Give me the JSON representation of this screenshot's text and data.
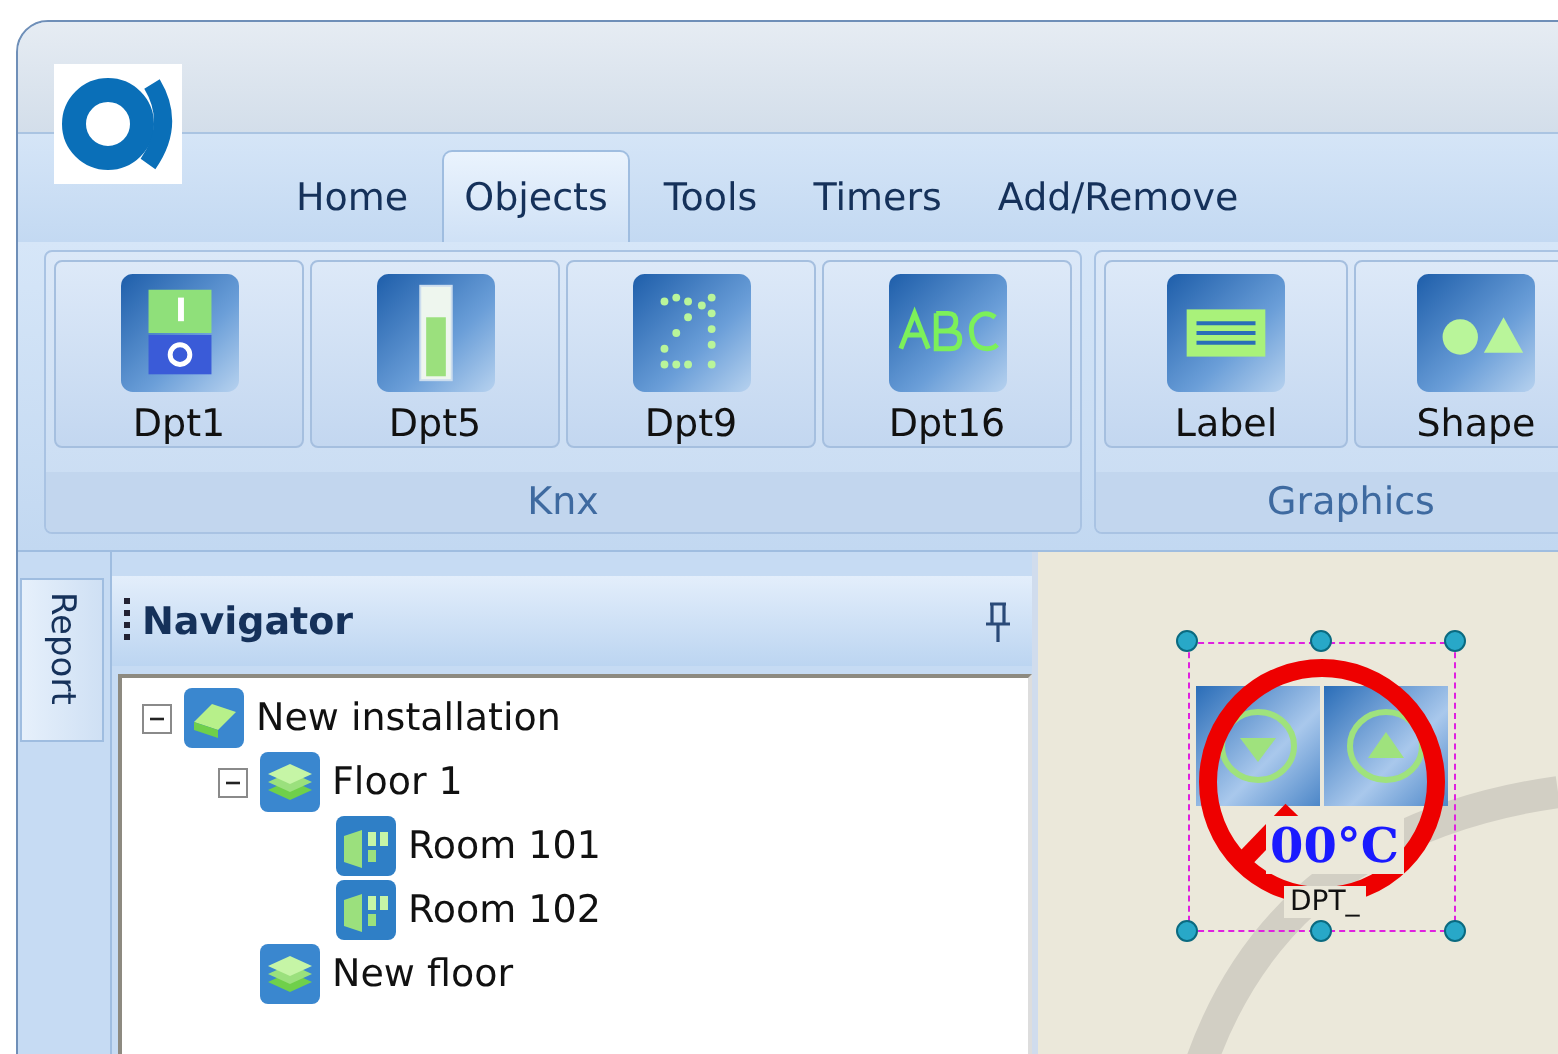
{
  "ribbon": {
    "tabs": [
      {
        "label": "Home",
        "selected": false
      },
      {
        "label": "Objects",
        "selected": true
      },
      {
        "label": "Tools",
        "selected": false
      },
      {
        "label": "Timers",
        "selected": false
      },
      {
        "label": "Add/Remove",
        "selected": false
      }
    ],
    "groups": [
      {
        "label": "Knx",
        "buttons": [
          {
            "label": "Dpt1",
            "kind": "switch"
          },
          {
            "label": "Dpt5",
            "kind": "bar"
          },
          {
            "label": "Dpt9",
            "kind": "digits"
          },
          {
            "label": "Dpt16",
            "kind": "text"
          }
        ]
      },
      {
        "label": "Graphics",
        "buttons": [
          {
            "label": "Label",
            "kind": "lines"
          },
          {
            "label": "Shape",
            "kind": "shapes"
          }
        ]
      }
    ]
  },
  "side_tabs": [
    {
      "label": "Report"
    }
  ],
  "navigator": {
    "title": "Navigator",
    "tree": [
      {
        "label": "New installation",
        "kind": "installation",
        "expanded": true,
        "children": [
          {
            "label": "Floor 1",
            "kind": "floor",
            "expanded": true,
            "children": [
              {
                "label": "Room 101",
                "kind": "room"
              },
              {
                "label": "Room 102",
                "kind": "room"
              }
            ]
          },
          {
            "label": "New floor",
            "kind": "floor"
          }
        ]
      }
    ]
  },
  "canvas": {
    "widget": {
      "value": "00°C",
      "caption": "DPT_",
      "disabled": true,
      "selected": true
    }
  }
}
